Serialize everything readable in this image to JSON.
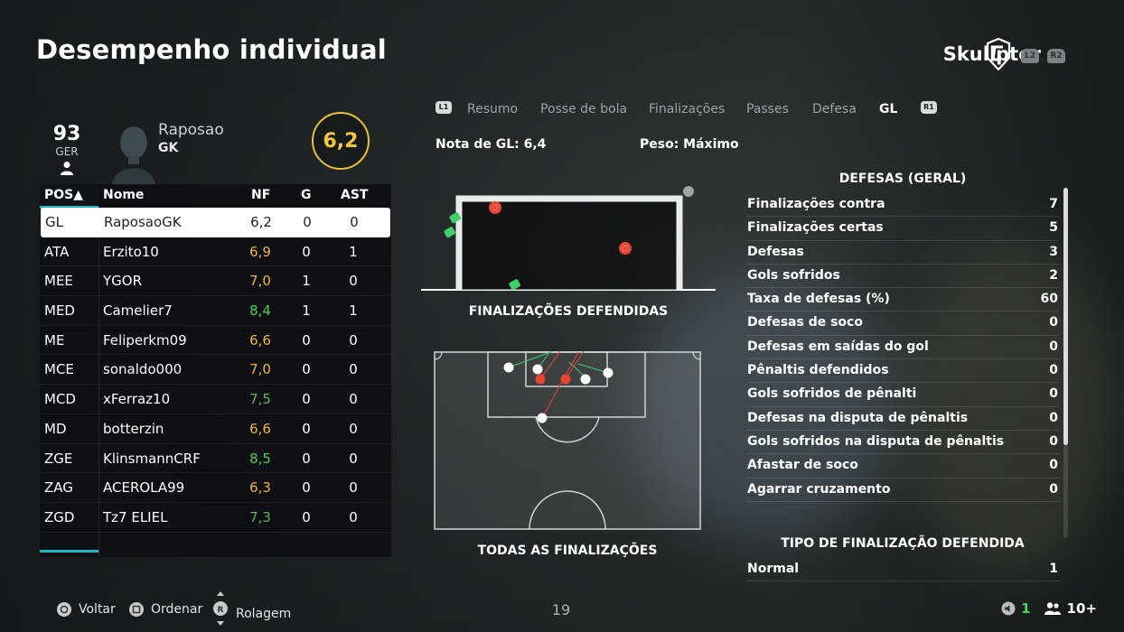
{
  "header": {
    "title": "Desempenho individual",
    "username": "Skullptor",
    "l2_label": "L2",
    "r2_label": "R2"
  },
  "player": {
    "overall": "93",
    "overall_label": "GER",
    "name": "Raposao",
    "position": "GK",
    "rating": "6,2"
  },
  "table": {
    "headers": {
      "pos": "POS▲",
      "name": "Nome",
      "nf": "NF",
      "g": "G",
      "ast": "AST"
    },
    "rows": [
      {
        "pos": "GL",
        "name": "RaposaoGK",
        "nf": "6,2",
        "g": "0",
        "ast": "0",
        "nf_color": "#222222"
      },
      {
        "pos": "ATA",
        "name": "Erzito10",
        "nf": "6,9",
        "g": "0",
        "ast": "1",
        "nf_color": "#f0b43a"
      },
      {
        "pos": "MEE",
        "name": "YGOR",
        "nf": "7,0",
        "g": "1",
        "ast": "0",
        "nf_color": "#f0b43a"
      },
      {
        "pos": "MED",
        "name": "Camelier7",
        "nf": "8,4",
        "g": "1",
        "ast": "1",
        "nf_color": "#49d35a"
      },
      {
        "pos": "ME",
        "name": "Feliperkm09",
        "nf": "6,6",
        "g": "0",
        "ast": "0",
        "nf_color": "#f0b43a"
      },
      {
        "pos": "MCE",
        "name": "sonaldo000",
        "nf": "7,0",
        "g": "0",
        "ast": "0",
        "nf_color": "#f0b43a"
      },
      {
        "pos": "MCD",
        "name": "xFerraz10",
        "nf": "7,5",
        "g": "0",
        "ast": "0",
        "nf_color": "#5fb35a"
      },
      {
        "pos": "MD",
        "name": "botterzin",
        "nf": "6,6",
        "g": "0",
        "ast": "0",
        "nf_color": "#f0b43a"
      },
      {
        "pos": "ZGE",
        "name": "KlinsmannCRF",
        "nf": "8,5",
        "g": "0",
        "ast": "0",
        "nf_color": "#49d35a"
      },
      {
        "pos": "ZAG",
        "name": "ACEROLA99",
        "nf": "6,3",
        "g": "0",
        "ast": "0",
        "nf_color": "#f0b43a"
      },
      {
        "pos": "ZGD",
        "name": "Tz7 ELIEL",
        "nf": "7,3",
        "g": "0",
        "ast": "0",
        "nf_color": "#5fb35a"
      }
    ]
  },
  "tabs": {
    "l1": "L1",
    "r1": "R1",
    "items": [
      "Resumo",
      "Posse de bola",
      "Finalizações",
      "Passes",
      "Defesa",
      "GL"
    ],
    "active": "GL"
  },
  "summary": {
    "gk_rating": "Nota de GL: 6,4",
    "weight": "Peso: Máximo"
  },
  "diagrams": {
    "saved_caption": "FINALIZAÇÕES DEFENDIDAS",
    "all_caption": "TODAS AS FINALIZAÇÕES"
  },
  "stats": {
    "section_title": "DEFESAS (GERAL)",
    "items": [
      {
        "label": "Finalizações contra",
        "value": "7"
      },
      {
        "label": "Finalizações certas",
        "value": "5"
      },
      {
        "label": "Defesas",
        "value": "3"
      },
      {
        "label": "Gols sofridos",
        "value": "2"
      },
      {
        "label": "Taxa de defesas (%)",
        "value": "60"
      },
      {
        "label": "Defesas de soco",
        "value": "0"
      },
      {
        "label": "Defesas em saídas do gol",
        "value": "0"
      },
      {
        "label": "Pênaltis defendidos",
        "value": "0"
      },
      {
        "label": "Gols sofridos de pênalti",
        "value": "0"
      },
      {
        "label": "Defesas na disputa de pênaltis",
        "value": "0"
      },
      {
        "label": "Gols sofridos na disputa de pênaltis",
        "value": "0"
      },
      {
        "label": "Afastar de soco",
        "value": "0"
      },
      {
        "label": "Agarrar cruzamento",
        "value": "0"
      }
    ],
    "section2_title": "TIPO DE FINALIZAÇÃO DEFENDIDA",
    "items2": [
      {
        "label": "Normal",
        "value": "1"
      }
    ]
  },
  "footer": {
    "back": "Voltar",
    "sort": "Ordenar",
    "scroll": "Rolagem",
    "r_label": "R",
    "page": "19",
    "count": "1",
    "players": "10+"
  },
  "colors": {
    "accent_cyan": "#1fb7c8",
    "rating_gold": "#f2c53d",
    "goal_red": "#e8452f",
    "save_green": "#3fd06a"
  }
}
